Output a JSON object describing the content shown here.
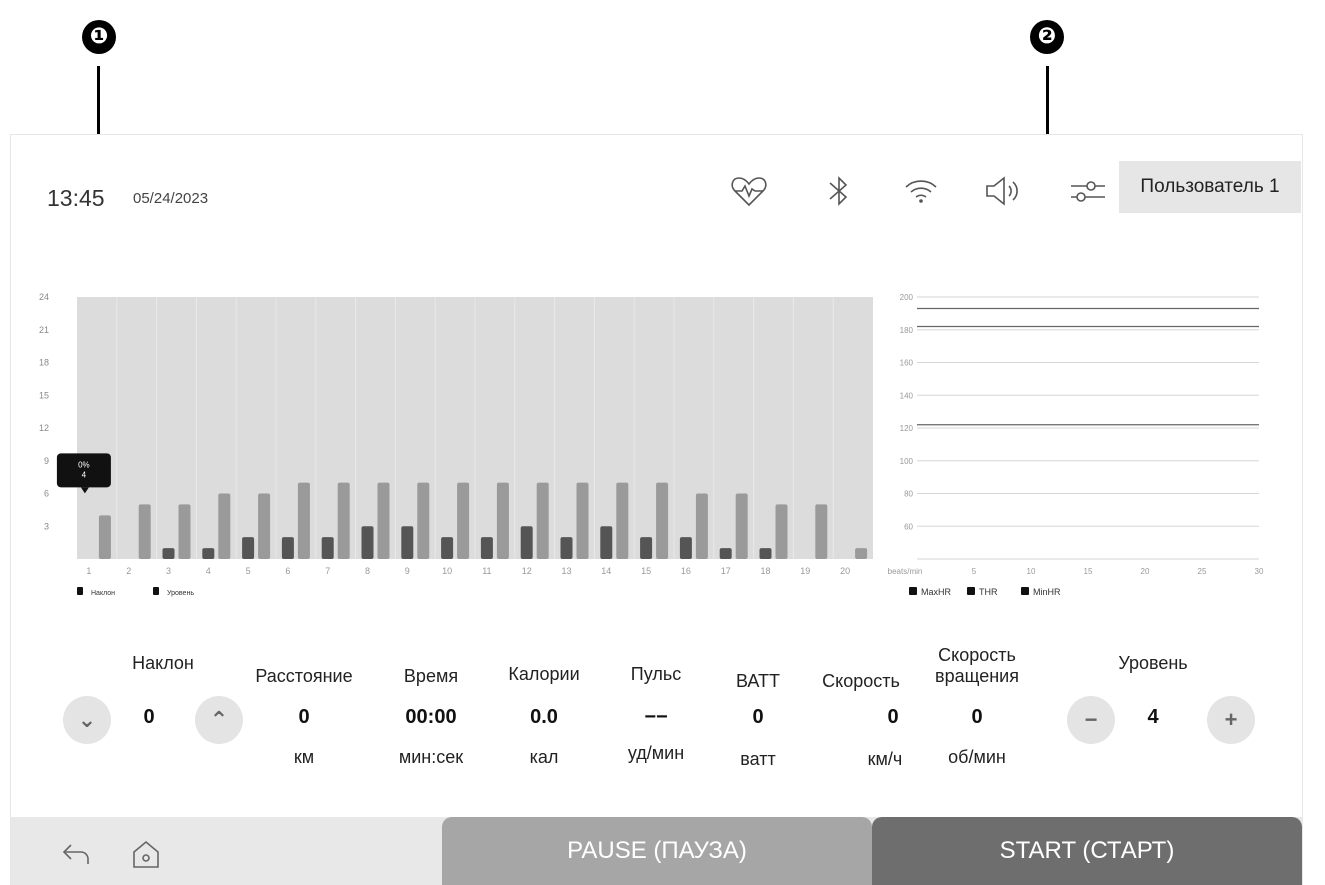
{
  "annotations": {
    "callout1": "❶",
    "callout2": "❷"
  },
  "status": {
    "time": "13:45",
    "date": "05/24/2023"
  },
  "icons": [
    "heart-rate-icon",
    "bluetooth-icon",
    "wifi-icon",
    "volume-icon",
    "settings-sliders-icon"
  ],
  "user_button": "Пользователь 1",
  "tooltip": {
    "line1": "0%",
    "line2": "4"
  },
  "stats": {
    "incline": {
      "label": "Наклон",
      "value": "0"
    },
    "distance": {
      "label": "Расстояние",
      "value": "0",
      "unit": "км"
    },
    "time": {
      "label": "Время",
      "value": "00:00",
      "unit": "мин:сек"
    },
    "calories": {
      "label": "Калории",
      "value": "0.0",
      "unit": "кал"
    },
    "pulse": {
      "label": "Пульс",
      "value": "−−",
      "unit": "уд/мин"
    },
    "watts": {
      "label": "ВАТТ",
      "value": "0",
      "unit": "ватт"
    },
    "speed": {
      "label": "Скорость",
      "value": "0",
      "unit": "км/ч"
    },
    "cadence": {
      "label1": "Скорость",
      "label2": "вращения",
      "value": "0",
      "unit": "об/мин"
    },
    "level": {
      "label": "Уровень",
      "value": "4"
    }
  },
  "bottom": {
    "pause_label": "PAUSE (ПАУЗА)",
    "start_label": "START (СТАРТ)"
  },
  "chart_data": [
    {
      "type": "bar",
      "categories": [
        "1",
        "2",
        "3",
        "4",
        "5",
        "6",
        "7",
        "8",
        "9",
        "10",
        "11",
        "12",
        "13",
        "14",
        "15",
        "16",
        "17",
        "18",
        "19",
        "20"
      ],
      "series": [
        {
          "name": "Наклон",
          "color": "#555555",
          "values": [
            0,
            0,
            1,
            1,
            2,
            2,
            2,
            3,
            3,
            2,
            2,
            3,
            2,
            3,
            2,
            2,
            1,
            1,
            0,
            0
          ]
        },
        {
          "name": "Уровень",
          "color": "#9a9a9a",
          "values": [
            4,
            5,
            5,
            6,
            6,
            7,
            7,
            7,
            7,
            7,
            7,
            7,
            7,
            7,
            7,
            6,
            6,
            5,
            5,
            1
          ]
        }
      ],
      "yticks": [
        3,
        6,
        9,
        12,
        15,
        18,
        21,
        24
      ],
      "ylim": [
        0,
        24
      ],
      "grid": true,
      "legend": "bottom-left"
    },
    {
      "type": "line",
      "xlabel": "beats/min",
      "xticks": [
        5,
        10,
        15,
        20,
        25,
        30
      ],
      "xlim": [
        0,
        30
      ],
      "yticks": [
        60,
        80,
        100,
        120,
        140,
        160,
        180,
        200
      ],
      "ylim": [
        40,
        200
      ],
      "legend_entries": [
        "MaxHR",
        "THR",
        "MinHR"
      ],
      "reference_lines": [
        {
          "name": "MaxHR",
          "y": 193
        },
        {
          "name": "THR",
          "y": 182
        },
        {
          "name": "MinHR",
          "y": 122
        }
      ],
      "grid": true,
      "legend": "bottom-left"
    }
  ]
}
